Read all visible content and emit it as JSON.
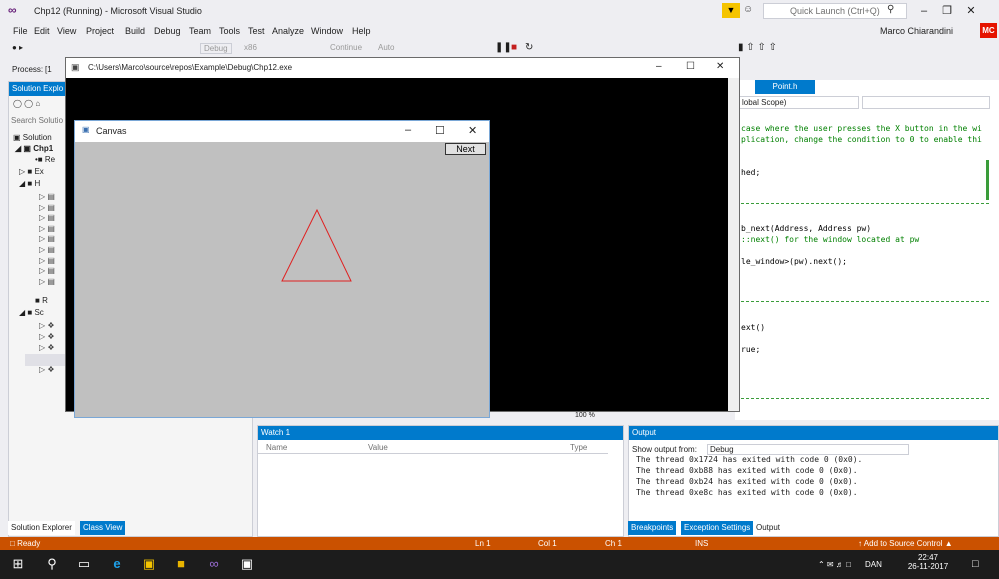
{
  "app": {
    "title": "Chp12 (Running) - Microsoft Visual Studio",
    "quick_launch_placeholder": "Quick Launch (Ctrl+Q)",
    "user": "Marco Chiarandini",
    "user_initials": "MC",
    "accent_color": "#007acc",
    "status_color": "#ca5100"
  },
  "menu": [
    "File",
    "Edit",
    "View",
    "Project",
    "Build",
    "Debug",
    "Team",
    "Tools",
    "Test",
    "Analyze",
    "Window",
    "Help"
  ],
  "toolbar": {
    "config": "Debug",
    "platform": "x86",
    "continue": "Continue",
    "auto": "Auto",
    "process_label": "Process:",
    "process_value": "[1"
  },
  "solution_explorer": {
    "title": "Solution Explo",
    "search": "Search Solutio",
    "items": [
      "Solution",
      "Chp1",
      "Re",
      "Ex",
      "H",
      "R",
      "Sc"
    ],
    "bottom_tabs": [
      "Solution Explorer",
      "Class View"
    ]
  },
  "console": {
    "title": "C:\\Users\\Marco\\source\\repos\\Example\\Debug\\Chp12.exe"
  },
  "canvas_window": {
    "title": "Canvas",
    "next_button": "Next"
  },
  "editor": {
    "tab": "Point.h",
    "scope": "lobal Scope)",
    "lines": [
      "case where the user presses the X button in the wi",
      "plication, change the condition to 0 to enable thi",
      "hed;",
      "b_next(Address, Address pw)",
      "::next() for the window located at pw",
      "le_window>(pw).next();",
      "ext()",
      "rue;"
    ],
    "zoom": "100 %"
  },
  "watch": {
    "title": "Watch 1",
    "columns": [
      "Name",
      "Value",
      "Type"
    ]
  },
  "output": {
    "title": "Output",
    "show_from_label": "Show output from:",
    "show_from_value": "Debug",
    "lines": [
      "The thread 0x1724 has exited with code 0 (0x0).",
      "The thread 0xb88 has exited with code 0 (0x0).",
      "The thread 0xb24 has exited with code 0 (0x0).",
      "The thread 0xe8c has exited with code 0 (0x0)."
    ],
    "bottom_tabs": [
      "Breakpoints",
      "Exception Settings",
      "Output"
    ]
  },
  "status": {
    "ready": "Ready",
    "ln": "Ln 1",
    "col": "Col 1",
    "ch": "Ch 1",
    "ins": "INS",
    "source_control": "Add to Source Control"
  },
  "taskbar": {
    "time": "22:47",
    "date": "26-11-2017",
    "lang": "DAN"
  }
}
